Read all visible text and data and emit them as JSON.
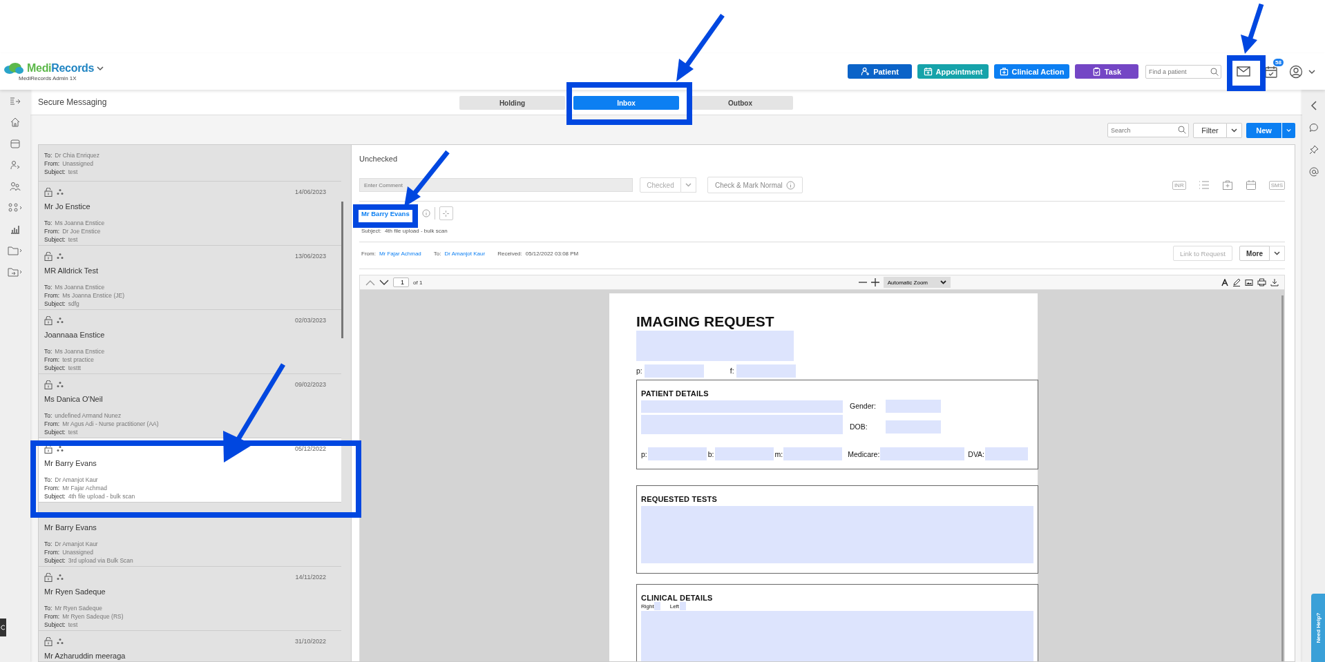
{
  "app": {
    "brand_first": "Medi",
    "brand_second": "Records",
    "account": "MediRecords Admin 1X"
  },
  "header_buttons": [
    {
      "label": "Patient",
      "kind": "patient",
      "color": "#0b63c8"
    },
    {
      "label": "Appointment",
      "kind": "appointment",
      "color": "#16a3aa"
    },
    {
      "label": "Clinical Action",
      "kind": "clinical",
      "color": "#0c7ff2"
    },
    {
      "label": "Task",
      "kind": "task",
      "color": "#7446c5"
    }
  ],
  "patient_search": {
    "placeholder": "Find a patient"
  },
  "tasks_badge": "58",
  "page_title": "Secure Messaging",
  "tabs": [
    {
      "label": "Holding",
      "selected": false
    },
    {
      "label": "Inbox",
      "selected": true
    },
    {
      "label": "Outbox",
      "selected": false
    }
  ],
  "list_toolbar": {
    "search_placeholder": "Search",
    "filter": "Filter",
    "new": "New"
  },
  "messages": [
    {
      "selected": false,
      "fields": [
        {
          "label": "To:",
          "value": "Dr Chia Enriquez"
        },
        {
          "label": "From:",
          "value": "Unassigned"
        },
        {
          "label": "Subject:",
          "value": "test"
        }
      ]
    },
    {
      "selected": false,
      "date": "14/06/2023",
      "name": "Mr Jo Enstice",
      "fields": [
        {
          "label": "To:",
          "value": "Ms Joanna Enstice"
        },
        {
          "label": "From:",
          "value": "Dr Joe Enstice"
        },
        {
          "label": "Subject:",
          "value": "test"
        }
      ]
    },
    {
      "selected": false,
      "date": "13/06/2023",
      "name": "MR Alldrick Test",
      "fields": [
        {
          "label": "To:",
          "value": "Ms Joanna Enstice"
        },
        {
          "label": "From:",
          "value": "Ms Joanna Enstice (JE)"
        },
        {
          "label": "Subject:",
          "value": "sdfg"
        }
      ]
    },
    {
      "selected": false,
      "date": "02/03/2023",
      "name": "Joannaaa Enstice",
      "fields": [
        {
          "label": "To:",
          "value": "Ms Joanna Enstice"
        },
        {
          "label": "From:",
          "value": "test practice"
        },
        {
          "label": "Subject:",
          "value": "testtt"
        }
      ]
    },
    {
      "selected": false,
      "date": "09/02/2023",
      "name": "Ms Danica O'Neil",
      "fields": [
        {
          "label": "To:",
          "value": "undefined Armand Nunez"
        },
        {
          "label": "From:",
          "value": "Mr Agus Adi - Nurse practitioner (AA)"
        },
        {
          "label": "Subject:",
          "value": "test"
        }
      ]
    },
    {
      "selected": true,
      "date": "05/12/2022",
      "name": "Mr Barry Evans",
      "fields": [
        {
          "label": "To:",
          "value": "Dr Amanjot Kaur"
        },
        {
          "label": "From:",
          "value": "Mr Fajar Achmad"
        },
        {
          "label": "Subject:",
          "value": "4th file upload - bulk scan"
        }
      ]
    },
    {
      "selected": false,
      "name": "Mr Barry Evans",
      "fields": [
        {
          "label": "To:",
          "value": "Dr Amanjot Kaur"
        },
        {
          "label": "From:",
          "value": "Unassigned"
        },
        {
          "label": "Subject:",
          "value": "3rd upload via Bulk Scan"
        }
      ]
    },
    {
      "selected": false,
      "date": "14/11/2022",
      "name": "Mr Ryen Sadeque",
      "fields": [
        {
          "label": "To:",
          "value": "Mr Ryen Sadeque"
        },
        {
          "label": "From:",
          "value": "Mr Ryen Sadeque (RS)"
        },
        {
          "label": "Subject:",
          "value": "test"
        }
      ]
    },
    {
      "selected": false,
      "date": "31/10/2022",
      "name": "Mr Azharuddin meeraga"
    }
  ],
  "detail": {
    "status": "Unchecked",
    "comment_placeholder": "Enter Comment",
    "checked_button": {
      "label": "Checked",
      "disabled": true
    },
    "check_normal": "Check & Mark Normal",
    "inr": "INR",
    "sms": "SMS",
    "patient_link": "Mr Barry Evans",
    "subject_label": "Subject:",
    "subject": "4th file upload - bulk scan",
    "from_label": "From:",
    "from": "Mr Fajar Achmad",
    "to_label": "To:",
    "to": "Dr Amanjot Kaur",
    "received_label": "Received:",
    "received": "05/12/2022 03:08 PM",
    "link_request": {
      "label": "Link to Request",
      "disabled": true
    },
    "more": "More"
  },
  "pdf_toolbar": {
    "page": "1",
    "page_count": "of 1",
    "zoom": "Automatic Zoom"
  },
  "document": {
    "title": "IMAGING REQUEST",
    "phone_label": "p:",
    "fax_label": "f:",
    "patient_heading": "PATIENT DETAILS",
    "gender_label": "Gender:",
    "dob_label": "DOB:",
    "p_label": "p:",
    "b_label": "b:",
    "m_label": "m:",
    "medicare_label": "Medicare:",
    "dva_label": "DVA:",
    "tests_heading": "REQUESTED TESTS",
    "clinical_heading": "CLINICAL DETAILS",
    "right_label": "Right",
    "left_label": "Left"
  },
  "help_tab": "Need Help?"
}
